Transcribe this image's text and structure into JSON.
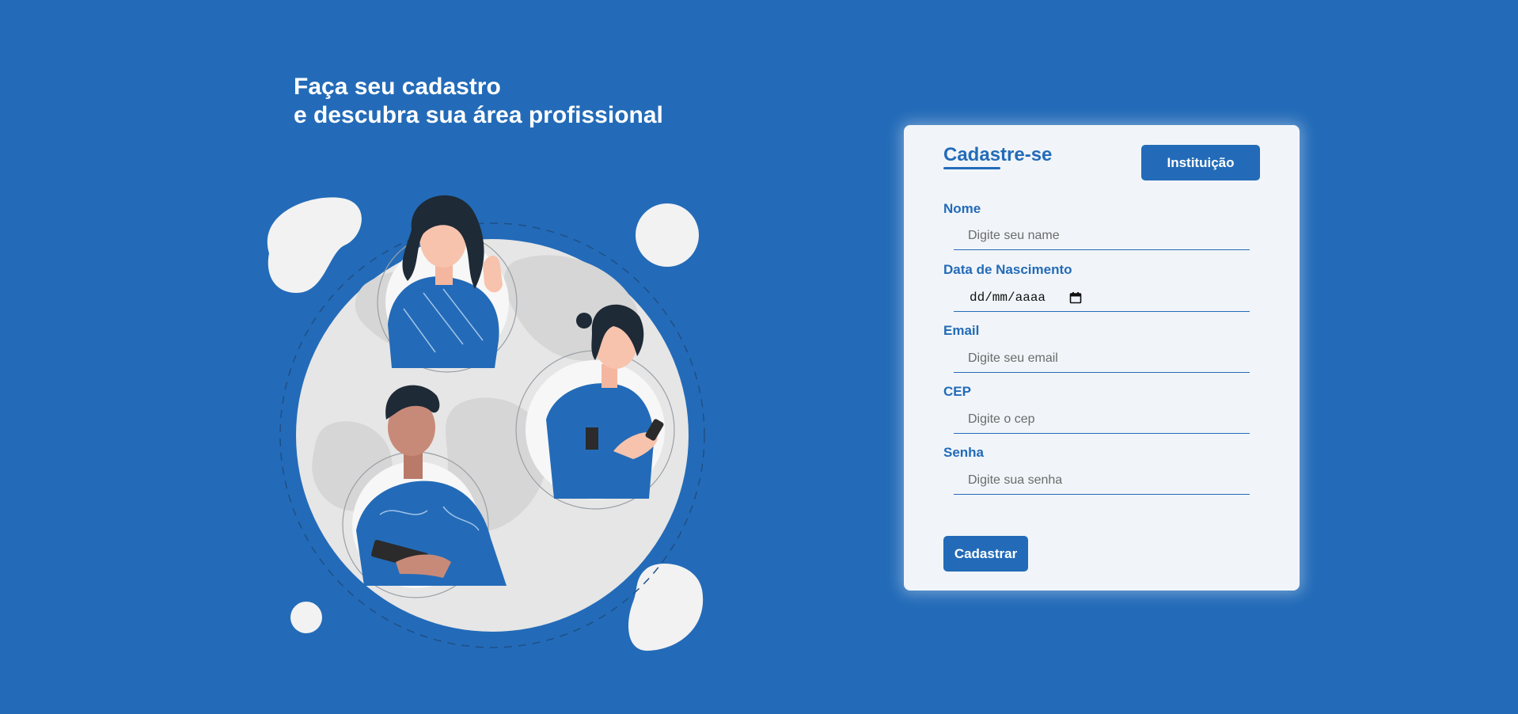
{
  "hero": {
    "line1": "Faça seu cadastro",
    "line2": "e descubra sua área profissional"
  },
  "form": {
    "title": "Cadastre-se",
    "institution_button": "Instituição",
    "fields": {
      "nome": {
        "label": "Nome",
        "placeholder": "Digite seu name"
      },
      "nascimento": {
        "label": "Data de Nascimento",
        "value": "dd/mm/aaaa",
        "icon": "calendar-icon"
      },
      "email": {
        "label": "Email",
        "placeholder": "Digite seu email"
      },
      "cep": {
        "label": "CEP",
        "placeholder": "Digite o cep"
      },
      "senha": {
        "label": "Senha",
        "placeholder": "Digite sua senha"
      }
    },
    "submit_button": "Cadastrar"
  },
  "colors": {
    "background": "#236bb8",
    "card": "#f1f5f9",
    "accent": "#236bb8",
    "globe": "#e6e6e6"
  }
}
